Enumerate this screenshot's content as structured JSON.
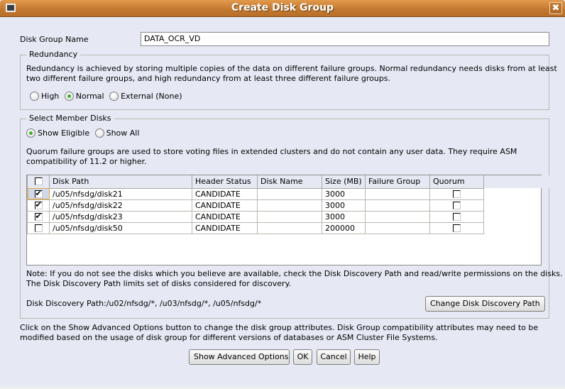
{
  "window": {
    "title": "Create Disk Group",
    "close_label": "x"
  },
  "disk_group_name": {
    "label": "Disk Group Name",
    "value": "DATA_OCR_VD"
  },
  "redundancy": {
    "legend": "Redundancy",
    "description_line1": "Redundancy is achieved by storing multiple copies of the data on different failure groups. Normal redundancy needs disks from at least",
    "description_line2": "two different failure groups, and high redundancy from at least three different failure groups.",
    "options": [
      {
        "label": "High",
        "selected": false
      },
      {
        "label": "Normal",
        "selected": true
      },
      {
        "label": "External (None)",
        "selected": false
      }
    ]
  },
  "member_disks": {
    "legend": "Select Member Disks",
    "filter_options": [
      {
        "label": "Show Eligible",
        "selected": true
      },
      {
        "label": "Show All",
        "selected": false
      }
    ],
    "quorum_note_line1": "Quorum failure groups are used to store voting files in extended clusters and do not contain any user data. They require ASM",
    "quorum_note_line2": "compatibility of 11.2 or higher.",
    "table": {
      "select_all_checked": false,
      "columns": [
        "Disk Path",
        "Header Status",
        "Disk Name",
        "Size (MB)",
        "Failure Group",
        "Quorum"
      ],
      "rows": [
        {
          "selected": true,
          "disk_path": "/u05/nfsdg/disk21",
          "header_status": "CANDIDATE",
          "disk_name": "",
          "size_mb": "3000",
          "failure_group": "",
          "quorum": false
        },
        {
          "selected": true,
          "disk_path": "/u05/nfsdg/disk22",
          "header_status": "CANDIDATE",
          "disk_name": "",
          "size_mb": "3000",
          "failure_group": "",
          "quorum": false
        },
        {
          "selected": true,
          "disk_path": "/u05/nfsdg/disk23",
          "header_status": "CANDIDATE",
          "disk_name": "",
          "size_mb": "3000",
          "failure_group": "",
          "quorum": false
        },
        {
          "selected": false,
          "disk_path": "/u05/nfsdg/disk50",
          "header_status": "CANDIDATE",
          "disk_name": "",
          "size_mb": "200000",
          "failure_group": "",
          "quorum": false
        }
      ]
    },
    "note_line1": "Note: If you do not see the disks which you believe are available, check the Disk Discovery Path and read/write permissions on the disks.",
    "note_line2": "The Disk Discovery Path limits set of disks considered for discovery.",
    "discovery_path_text": "Disk Discovery Path:/u02/nfsdg/*, /u03/nfsdg/*, /u05/nfsdg/*",
    "change_path_button": "Change Disk Discovery Path"
  },
  "advanced_note_line1": "Click on the Show Advanced Options button to change the disk group attributes. Disk Group compatibility attributes may need to be",
  "advanced_note_line2": "modified based on the usage of disk group for different versions of databases or ASM Cluster File Systems.",
  "buttons": {
    "advanced": "Show Advanced Options",
    "ok": "OK",
    "cancel": "Cancel",
    "help": "Help"
  }
}
